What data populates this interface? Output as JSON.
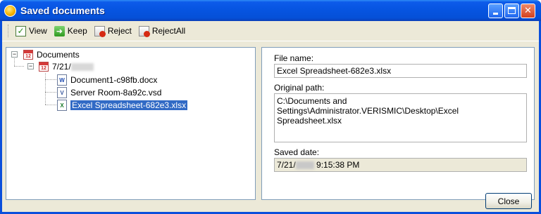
{
  "window": {
    "title": "Saved documents"
  },
  "toolbar": {
    "view_label": "View",
    "keep_label": "Keep",
    "reject_label": "Reject",
    "rejectall_label": "RejectAll"
  },
  "tree": {
    "root_label": "Documents",
    "date_node_label": "7/21/",
    "calendar_day": "12",
    "files": [
      {
        "label": "Document1-c98fb.docx",
        "icon": "word-doc-icon",
        "badge": "W"
      },
      {
        "label": "Server Room-8a92c.vsd",
        "icon": "visio-doc-icon",
        "badge": "V"
      },
      {
        "label": "Excel Spreadsheet-682e3.xlsx",
        "icon": "excel-doc-icon",
        "badge": "X",
        "selected": true
      }
    ]
  },
  "details": {
    "file_name_label": "File name:",
    "file_name_value": "Excel Spreadsheet-682e3.xlsx",
    "original_path_label": "Original path:",
    "original_path_value": "C:\\Documents and\nSettings\\Administrator.VERISMIC\\Desktop\\Excel\nSpreadsheet.xlsx",
    "saved_date_label": "Saved date:",
    "saved_date_prefix": "7/21/",
    "saved_date_time": "9:15:38 PM"
  },
  "footer": {
    "close_label": "Close"
  },
  "colors": {
    "titlebar": "#0654e0",
    "selection": "#316ac5",
    "client_bg": "#ece9d8"
  }
}
